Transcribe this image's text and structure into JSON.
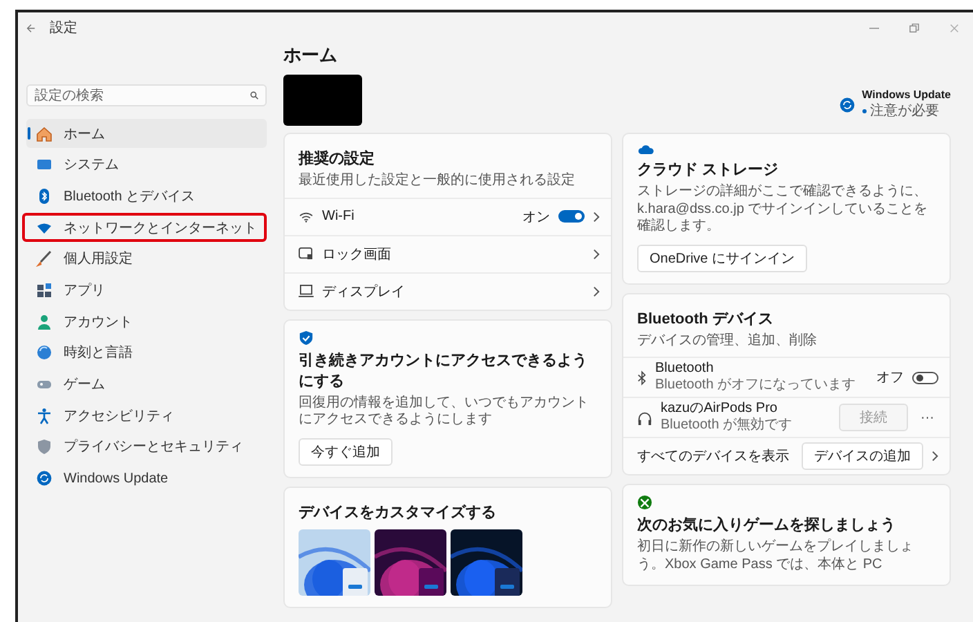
{
  "window": {
    "title": "設定"
  },
  "sidebar": {
    "search_placeholder": "設定の検索",
    "items": [
      {
        "label": "ホーム",
        "selected": true,
        "highlighted": false
      },
      {
        "label": "システム",
        "selected": false,
        "highlighted": false
      },
      {
        "label": "Bluetooth とデバイス",
        "selected": false,
        "highlighted": false
      },
      {
        "label": "ネットワークとインターネット",
        "selected": false,
        "highlighted": true
      },
      {
        "label": "個人用設定",
        "selected": false,
        "highlighted": false
      },
      {
        "label": "アプリ",
        "selected": false,
        "highlighted": false
      },
      {
        "label": "アカウント",
        "selected": false,
        "highlighted": false
      },
      {
        "label": "時刻と言語",
        "selected": false,
        "highlighted": false
      },
      {
        "label": "ゲーム",
        "selected": false,
        "highlighted": false
      },
      {
        "label": "アクセシビリティ",
        "selected": false,
        "highlighted": false
      },
      {
        "label": "プライバシーとセキュリティ",
        "selected": false,
        "highlighted": false
      },
      {
        "label": "Windows Update",
        "selected": false,
        "highlighted": false
      }
    ]
  },
  "main": {
    "title": "ホーム",
    "update": {
      "title": "Windows Update",
      "status": "注意が必要"
    },
    "recommended": {
      "title": "推奨の設定",
      "subtitle": "最近使用した設定と一般的に使用される設定",
      "rows": [
        {
          "kind": "toggle",
          "label": "Wi-Fi",
          "state_label": "オン",
          "on": true
        },
        {
          "kind": "link",
          "label": "ロック画面"
        },
        {
          "kind": "link",
          "label": "ディスプレイ"
        }
      ]
    },
    "account": {
      "title": "引き続きアカウントにアクセスできるようにする",
      "description": "回復用の情報を追加して、いつでもアカウントにアクセスできるようにします",
      "button": "今すぐ追加"
    },
    "customize": {
      "title": "デバイスをカスタマイズする"
    },
    "cloud": {
      "title": "クラウド ストレージ",
      "description": "ストレージの詳細がここで確認できるように、k.hara@dss.co.jp でサインインしていることを確認します。",
      "button": "OneDrive にサインイン"
    },
    "bluetooth": {
      "title": "Bluetooth デバイス",
      "subtitle": "デバイスの管理、追加、削除",
      "rows": [
        {
          "kind": "toggle",
          "name": "Bluetooth",
          "status": "Bluetooth がオフになっています",
          "state_label": "オフ",
          "on": false
        },
        {
          "kind": "device",
          "name": "kazuのAirPods Pro",
          "status": "Bluetooth が無効です",
          "button": "接続",
          "disabled": true,
          "more": "···"
        }
      ],
      "footer": {
        "label": "すべてのデバイスを表示",
        "button": "デバイスの追加"
      }
    },
    "xbox": {
      "title": "次のお気に入りゲームを探しましょう",
      "description": "初日に新作の新しいゲームをプレイしましょう。Xbox Game Pass では、本体と PC"
    }
  }
}
